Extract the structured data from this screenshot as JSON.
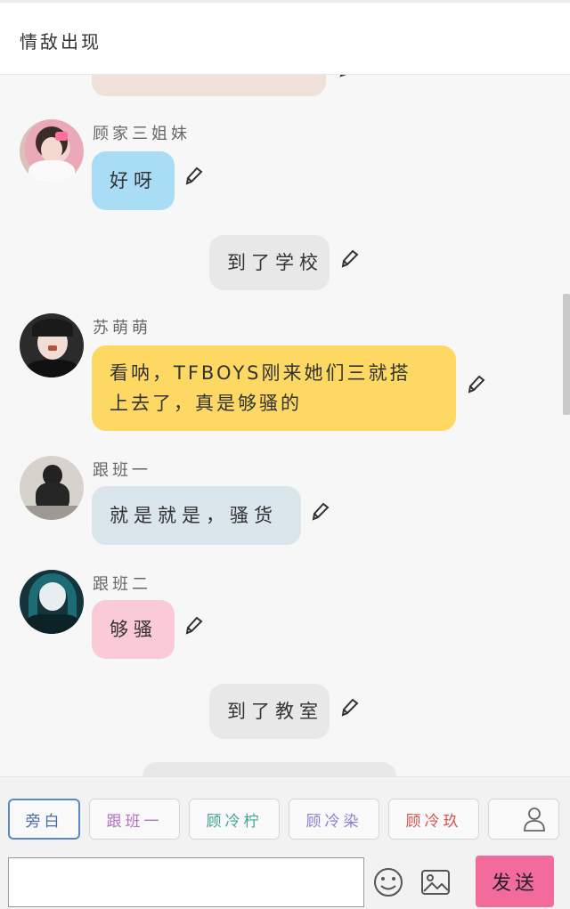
{
  "header": {
    "title": "情敌出现"
  },
  "messages": {
    "m1": {
      "name": "顾家三姐妹",
      "text": "好呀"
    },
    "m2": {
      "text": "到了学校"
    },
    "m3": {
      "name": "苏萌萌",
      "text_line1": "看呐，TFBOYS刚来她们三就搭",
      "text_line2": "上去了，真是够骚的"
    },
    "m4": {
      "name": "跟班一",
      "text": "就是就是，骚货"
    },
    "m5": {
      "name": "跟班二",
      "text": "够骚"
    },
    "m6": {
      "text": "到了教室"
    }
  },
  "roles": [
    "旁白",
    "跟班一",
    "顾冷柠",
    "顾冷染",
    "顾冷玖"
  ],
  "send_label": "发送",
  "colors": {
    "blue_bubble": "#a9ddf5",
    "gray_bubble": "#e8e8e8",
    "yellow_bubble": "#fdd964",
    "slate_bubble": "#dbe5ec",
    "pink_bubble": "#fbcad7",
    "peach_bubble": "#f0e0da",
    "send_button": "#f36b9b",
    "role_narrator": "#4a6aa5",
    "role_follower": "#b56fc4",
    "role_lemon": "#3fa68c",
    "role_ran": "#8c7fd1",
    "role_jiu": "#d9534f"
  },
  "icons": [
    "pencil-icon",
    "emoji-icon",
    "image-icon",
    "user-icon"
  ]
}
